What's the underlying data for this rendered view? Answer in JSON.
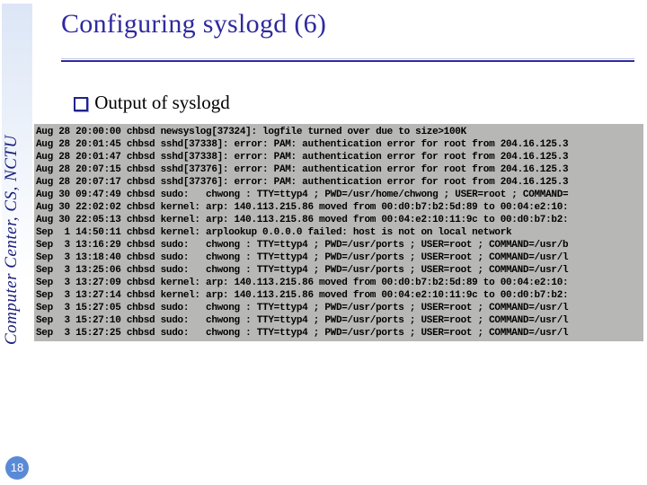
{
  "sidebar": {
    "label": "Computer Center, CS, NCTU"
  },
  "title": "Configuring syslogd (6)",
  "bullet": {
    "text": "Output of syslogd"
  },
  "page_number": "18",
  "terminal_lines": [
    "Aug 28 20:00:00 chbsd newsyslog[37324]: logfile turned over due to size>100K",
    "Aug 28 20:01:45 chbsd sshd[37338]: error: PAM: authentication error for root from 204.16.125.3",
    "Aug 28 20:01:47 chbsd sshd[37338]: error: PAM: authentication error for root from 204.16.125.3",
    "Aug 28 20:07:15 chbsd sshd[37376]: error: PAM: authentication error for root from 204.16.125.3",
    "Aug 28 20:07:17 chbsd sshd[37376]: error: PAM: authentication error for root from 204.16.125.3",
    "Aug 30 09:47:49 chbsd sudo:   chwong : TTY=ttyp4 ; PWD=/usr/home/chwong ; USER=root ; COMMAND=",
    "Aug 30 22:02:02 chbsd kernel: arp: 140.113.215.86 moved from 00:d0:b7:b2:5d:89 to 00:04:e2:10:",
    "Aug 30 22:05:13 chbsd kernel: arp: 140.113.215.86 moved from 00:04:e2:10:11:9c to 00:d0:b7:b2:",
    "Sep  1 14:50:11 chbsd kernel: arplookup 0.0.0.0 failed: host is not on local network",
    "Sep  3 13:16:29 chbsd sudo:   chwong : TTY=ttyp4 ; PWD=/usr/ports ; USER=root ; COMMAND=/usr/b",
    "Sep  3 13:18:40 chbsd sudo:   chwong : TTY=ttyp4 ; PWD=/usr/ports ; USER=root ; COMMAND=/usr/l",
    "Sep  3 13:25:06 chbsd sudo:   chwong : TTY=ttyp4 ; PWD=/usr/ports ; USER=root ; COMMAND=/usr/l",
    "Sep  3 13:27:09 chbsd kernel: arp: 140.113.215.86 moved from 00:d0:b7:b2:5d:89 to 00:04:e2:10:",
    "Sep  3 13:27:14 chbsd kernel: arp: 140.113.215.86 moved from 00:04:e2:10:11:9c to 00:d0:b7:b2:",
    "Sep  3 15:27:05 chbsd sudo:   chwong : TTY=ttyp4 ; PWD=/usr/ports ; USER=root ; COMMAND=/usr/l",
    "Sep  3 15:27:10 chbsd sudo:   chwong : TTY=ttyp4 ; PWD=/usr/ports ; USER=root ; COMMAND=/usr/l",
    "Sep  3 15:27:25 chbsd sudo:   chwong : TTY=ttyp4 ; PWD=/usr/ports ; USER=root ; COMMAND=/usr/l"
  ]
}
